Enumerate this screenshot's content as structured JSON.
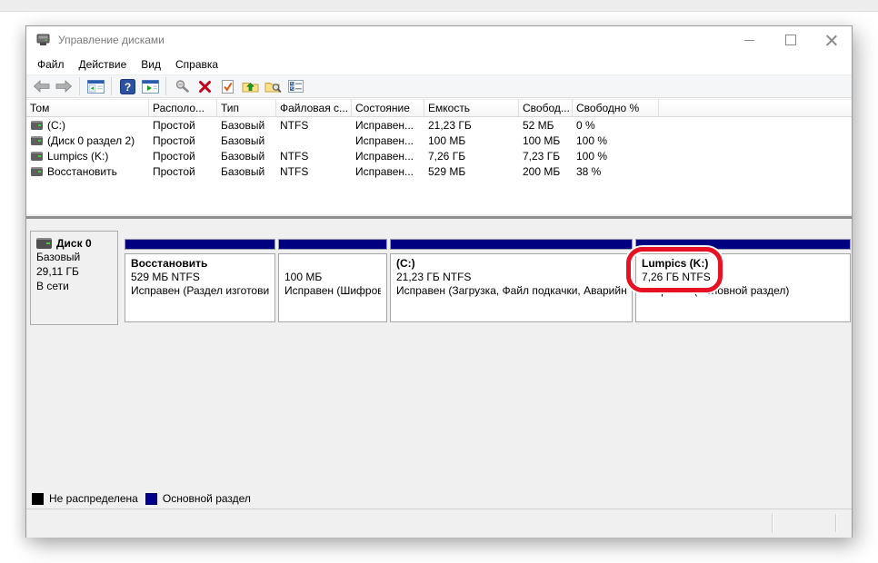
{
  "window": {
    "title": "Управление дисками"
  },
  "menu": {
    "items": [
      "Файл",
      "Действие",
      "Вид",
      "Справка"
    ]
  },
  "toolbar": {
    "icons": [
      "back-icon",
      "forward-icon",
      "console-tree-icon",
      "help-icon",
      "action-pane-icon",
      "properties-tool-icon",
      "delete-volume-icon",
      "mark-active-icon",
      "open-folder-up-icon",
      "explore-folder-icon",
      "view-options-icon"
    ]
  },
  "volume_table": {
    "columns": [
      "Том",
      "Располо...",
      "Тип",
      "Файловая с...",
      "Состояние",
      "Емкость",
      "Свобод...",
      "Свободно %"
    ],
    "rows": [
      {
        "volume": "(C:)",
        "layout": "Простой",
        "type": "Базовый",
        "fs": "NTFS",
        "status": "Исправен...",
        "capacity": "21,23 ГБ",
        "free": "52 МБ",
        "free_pct": "0 %"
      },
      {
        "volume": "(Диск 0 раздел 2)",
        "layout": "Простой",
        "type": "Базовый",
        "fs": "",
        "status": "Исправен...",
        "capacity": "100 МБ",
        "free": "100 МБ",
        "free_pct": "100 %"
      },
      {
        "volume": "Lumpics (K:)",
        "layout": "Простой",
        "type": "Базовый",
        "fs": "NTFS",
        "status": "Исправен...",
        "capacity": "7,26 ГБ",
        "free": "7,23 ГБ",
        "free_pct": "100 %"
      },
      {
        "volume": "Восстановить",
        "layout": "Простой",
        "type": "Базовый",
        "fs": "NTFS",
        "status": "Исправен...",
        "capacity": "529 МБ",
        "free": "200 МБ",
        "free_pct": "38 %"
      }
    ]
  },
  "disk": {
    "name": "Диск 0",
    "type": "Базовый",
    "size": "29,11 ГБ",
    "status": "В сети"
  },
  "partitions": [
    {
      "name": "Восстановить",
      "info": "529 МБ NTFS",
      "status": "Исправен (Раздел изготовит"
    },
    {
      "name": "",
      "info": "100 МБ",
      "status": "Исправен (Шифров"
    },
    {
      "name": "(C:)",
      "info": "21,23 ГБ NTFS",
      "status": "Исправен (Загрузка, Файл подкачки, Аварийн"
    },
    {
      "name": "Lumpics (K:)",
      "info": "7,26 ГБ NTFS",
      "status": "Исправен (Основной раздел)"
    }
  ],
  "legend": {
    "items": [
      {
        "label": "Не распределена",
        "color": "#000000"
      },
      {
        "label": "Основной раздел",
        "color": "#00008b"
      }
    ]
  },
  "colors": {
    "partition_bar": "#000080",
    "annotation_highlight": "#e81123"
  }
}
